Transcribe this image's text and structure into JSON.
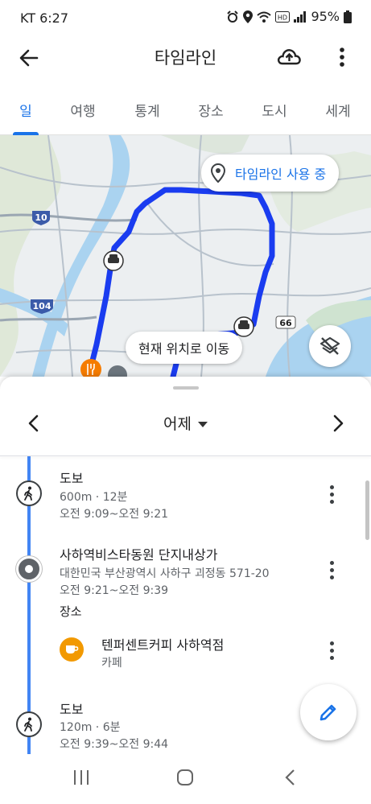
{
  "status_bar": {
    "carrier_time": "KT 6:27",
    "battery": "95%"
  },
  "app_bar": {
    "title": "타임라인"
  },
  "tabs": [
    {
      "label": "일",
      "active": true
    },
    {
      "label": "여행",
      "active": false
    },
    {
      "label": "통계",
      "active": false
    },
    {
      "label": "장소",
      "active": false
    },
    {
      "label": "도시",
      "active": false
    },
    {
      "label": "세계",
      "active": false
    }
  ],
  "map": {
    "timeline_chip": "타임라인 사용 중",
    "move_to_location": "현재 위치로 이동",
    "road_shields": [
      "10",
      "104",
      "66"
    ],
    "route_color": "#1a3cf0"
  },
  "day_nav": {
    "label": "어제"
  },
  "timeline": [
    {
      "type": "walk",
      "title": "도보",
      "meta": "600m · 12분",
      "time": "오전 9:09~오전 9:21"
    },
    {
      "type": "place",
      "title": "사하역비스타동원 단지내상가",
      "address": "대한민국 부산광역시 사하구 괴정동 571-20",
      "time": "오전 9:21~오전 9:39",
      "section_label": "장소",
      "child": {
        "title": "텐퍼센트커피 사하역점",
        "category": "카페"
      }
    },
    {
      "type": "walk",
      "title": "도보",
      "meta": "120m · 6분",
      "time": "오전 9:39~오전 9:44"
    }
  ],
  "colors": {
    "accent": "#1a73e8",
    "rail": "#4285f4",
    "cafe": "#f29900"
  }
}
